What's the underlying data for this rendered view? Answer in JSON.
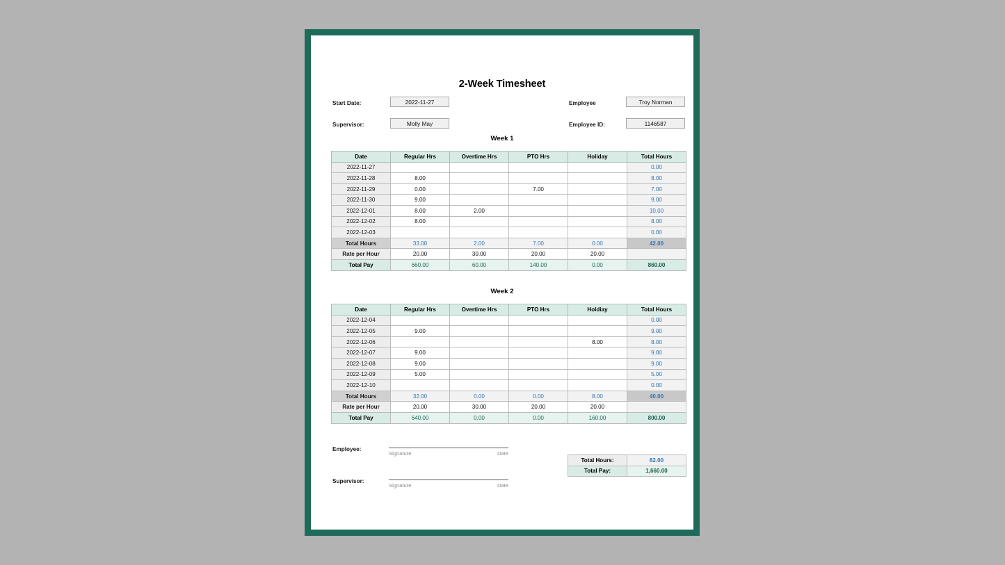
{
  "theme": {
    "frame_color": "#1e6b5a",
    "canvas_color": "#b3b3b3",
    "header_fill": "#d8ece5",
    "total_pay_fill": "#e6f3ee",
    "total_hours_fill": "#c8c8c8",
    "blue_value": "#2e74b5",
    "teal_value": "#1d5c50"
  },
  "document": {
    "title": "2-Week Timesheet"
  },
  "header": {
    "start_date_label": "Start Date:",
    "start_date_value": "2022-11-27",
    "supervisor_label": "Supervisor:",
    "supervisor_value": "Molly May",
    "employee_label": "Employee",
    "employee_value": "Troy Norman",
    "employee_id_label": "Employee ID:",
    "employee_id_value": "1146587"
  },
  "week1": {
    "heading": "Week 1",
    "columns": [
      "Date",
      "Regular Hrs",
      "Overtime Hrs",
      "PTO Hrs",
      "Holiday",
      "Total Hours"
    ],
    "rows": [
      {
        "date": "2022-11-27",
        "regular": "",
        "overtime": "",
        "pto": "",
        "holiday": "",
        "total": "0.00"
      },
      {
        "date": "2022-11-28",
        "regular": "8.00",
        "overtime": "",
        "pto": "",
        "holiday": "",
        "total": "8.00"
      },
      {
        "date": "2022-11-29",
        "regular": "0.00",
        "overtime": "",
        "pto": "7.00",
        "holiday": "",
        "total": "7.00"
      },
      {
        "date": "2022-11-30",
        "regular": "9.00",
        "overtime": "",
        "pto": "",
        "holiday": "",
        "total": "9.00"
      },
      {
        "date": "2022-12-01",
        "regular": "8.00",
        "overtime": "2.00",
        "pto": "",
        "holiday": "",
        "total": "10.00"
      },
      {
        "date": "2022-12-02",
        "regular": "8.00",
        "overtime": "",
        "pto": "",
        "holiday": "",
        "total": "8.00"
      },
      {
        "date": "2022-12-03",
        "regular": "",
        "overtime": "",
        "pto": "",
        "holiday": "",
        "total": "0.00"
      }
    ],
    "total_hours": {
      "label": "Total Hours",
      "regular": "33.00",
      "overtime": "2.00",
      "pto": "7.00",
      "holiday": "0.00",
      "total": "42.00"
    },
    "rate_per_hour": {
      "label": "Rate per Hour",
      "regular": "20.00",
      "overtime": "30.00",
      "pto": "20.00",
      "holiday": "20.00",
      "total": ""
    },
    "total_pay": {
      "label": "Total Pay",
      "regular": "660.00",
      "overtime": "60.00",
      "pto": "140.00",
      "holiday": "0.00",
      "total": "860.00"
    }
  },
  "week2": {
    "heading": "Week 2",
    "columns": [
      "Date",
      "Regular Hrs",
      "Overtime Hrs",
      "PTO Hrs",
      "Holdiay",
      "Total Hours"
    ],
    "rows": [
      {
        "date": "2022-12-04",
        "regular": "",
        "overtime": "",
        "pto": "",
        "holiday": "",
        "total": "0.00"
      },
      {
        "date": "2022-12-05",
        "regular": "9.00",
        "overtime": "",
        "pto": "",
        "holiday": "",
        "total": "9.00"
      },
      {
        "date": "2022-12-06",
        "regular": "",
        "overtime": "",
        "pto": "",
        "holiday": "8.00",
        "total": "8.00"
      },
      {
        "date": "2022-12-07",
        "regular": "9.00",
        "overtime": "",
        "pto": "",
        "holiday": "",
        "total": "9.00"
      },
      {
        "date": "2022-12-08",
        "regular": "9.00",
        "overtime": "",
        "pto": "",
        "holiday": "",
        "total": "9.00"
      },
      {
        "date": "2022-12-09",
        "regular": "5.00",
        "overtime": "",
        "pto": "",
        "holiday": "",
        "total": "5.00"
      },
      {
        "date": "2022-12-10",
        "regular": "",
        "overtime": "",
        "pto": "",
        "holiday": "",
        "total": "0.00"
      }
    ],
    "total_hours": {
      "label": "Total Hours",
      "regular": "32.00",
      "overtime": "0.00",
      "pto": "0.00",
      "holiday": "8.00",
      "total": "40.00"
    },
    "rate_per_hour": {
      "label": "Rate per Hour",
      "regular": "20.00",
      "overtime": "30.00",
      "pto": "20.00",
      "holiday": "20.00",
      "total": ""
    },
    "total_pay": {
      "label": "Total Pay",
      "regular": "640.00",
      "overtime": "0.00",
      "pto": "0.00",
      "holiday": "160.00",
      "total": "800.00"
    }
  },
  "signatures": {
    "employee_label": "Employee:",
    "supervisor_label": "Supervisor:",
    "signature_caption": "Signature",
    "date_caption": "Date"
  },
  "grand_totals": {
    "hours_label": "Total Hours:",
    "hours_value": "82.00",
    "pay_label": "Total Pay:",
    "pay_value": "1,660.00"
  }
}
